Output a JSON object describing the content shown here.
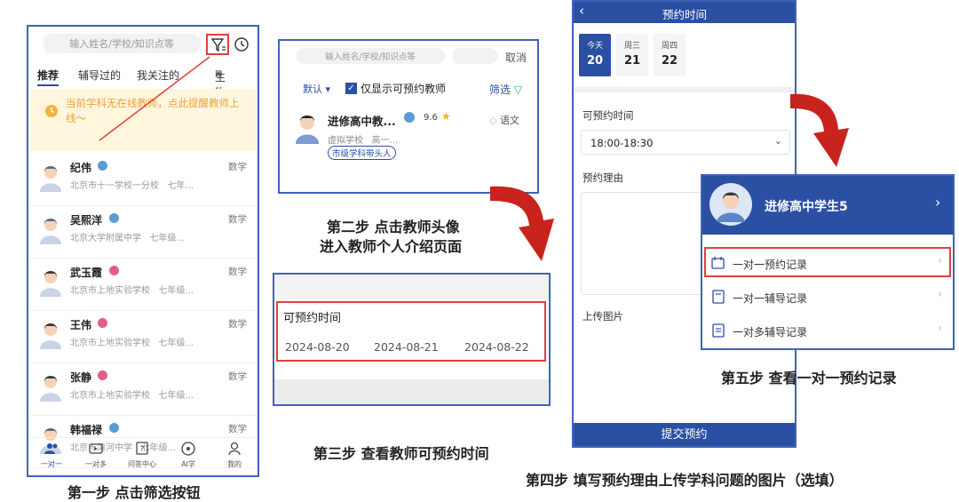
{
  "step1": {
    "search_placeholder": "输入姓名/学校/知识点等",
    "tabs": [
      "推荐",
      "辅导过的",
      "我关注的"
    ],
    "subject_filter": "生物",
    "notice": "当前学科无在线教师，点此提醒教师上线～",
    "teachers": [
      {
        "name": "纪伟",
        "school": "北京市十一学校一分校",
        "grade": "七年...",
        "subject": "数学",
        "badge_color": "#5b9bd5"
      },
      {
        "name": "吴熙洋",
        "school": "北京大学附属中学",
        "grade": "七年级...",
        "subject": "数学",
        "badge_color": "#5b9bd5"
      },
      {
        "name": "武玉霞",
        "school": "北京市上地实验学校",
        "grade": "七年级...",
        "subject": "数学",
        "badge_color": "#e35d8a"
      },
      {
        "name": "王伟",
        "school": "北京市上地实验学校",
        "grade": "七年级...",
        "subject": "数学",
        "badge_color": "#e35d8a"
      },
      {
        "name": "张静",
        "school": "北京市上地实验学校",
        "grade": "七年级...",
        "subject": "数学",
        "badge_color": "#e35d8a"
      },
      {
        "name": "韩福禄",
        "school": "北京市清河中学",
        "grade": "七年级...",
        "subject": "数学",
        "badge_color": "#5b9bd5"
      }
    ],
    "nav": [
      "一对一",
      "一对多",
      "问答中心",
      "AI学",
      "我的"
    ],
    "caption": "第一步 点击筛选按钮"
  },
  "step2": {
    "search_placeholder": "输入姓名/学校/知识点等",
    "cancel": "取消",
    "sort": "默认",
    "checkbox_label": "仅显示可预约教师",
    "filter": "筛选",
    "teacher_name": "进修高中教...",
    "rating": "9.6",
    "subject": "语文",
    "school": "虚拟学校",
    "grade": "高一...",
    "tag": "市级学科带头人",
    "caption_line1": "第二步 点击教师头像",
    "caption_line2": "进入教师个人介绍页面"
  },
  "step3": {
    "label": "可预约时间",
    "dates": [
      "2024-08-20",
      "2024-08-21",
      "2024-08-22"
    ],
    "caption": "第三步 查看教师可预约时间"
  },
  "step4": {
    "title": "预约时间",
    "days": [
      {
        "weekday": "今天",
        "date": "20"
      },
      {
        "weekday": "周三",
        "date": "21"
      },
      {
        "weekday": "周四",
        "date": "22"
      }
    ],
    "time_label": "可预约时间",
    "time_value": "18:00-18:30",
    "reason_label": "预约理由",
    "upload_label": "上传图片",
    "submit": "提交预约",
    "caption": "第四步 填写预约理由上传学科问题的图片（选填）"
  },
  "step5": {
    "user_name": "进修高中学生5",
    "menu": [
      "一对一预约记录",
      "一对一辅导记录",
      "一对多辅导记录"
    ],
    "caption": "第五步 查看一对一预约记录"
  },
  "colors": {
    "brand_blue": "#2b4fa3",
    "accent_blue": "#3b7bf0",
    "highlight_red": "#e0403a",
    "arrow_red": "#c8231c"
  }
}
